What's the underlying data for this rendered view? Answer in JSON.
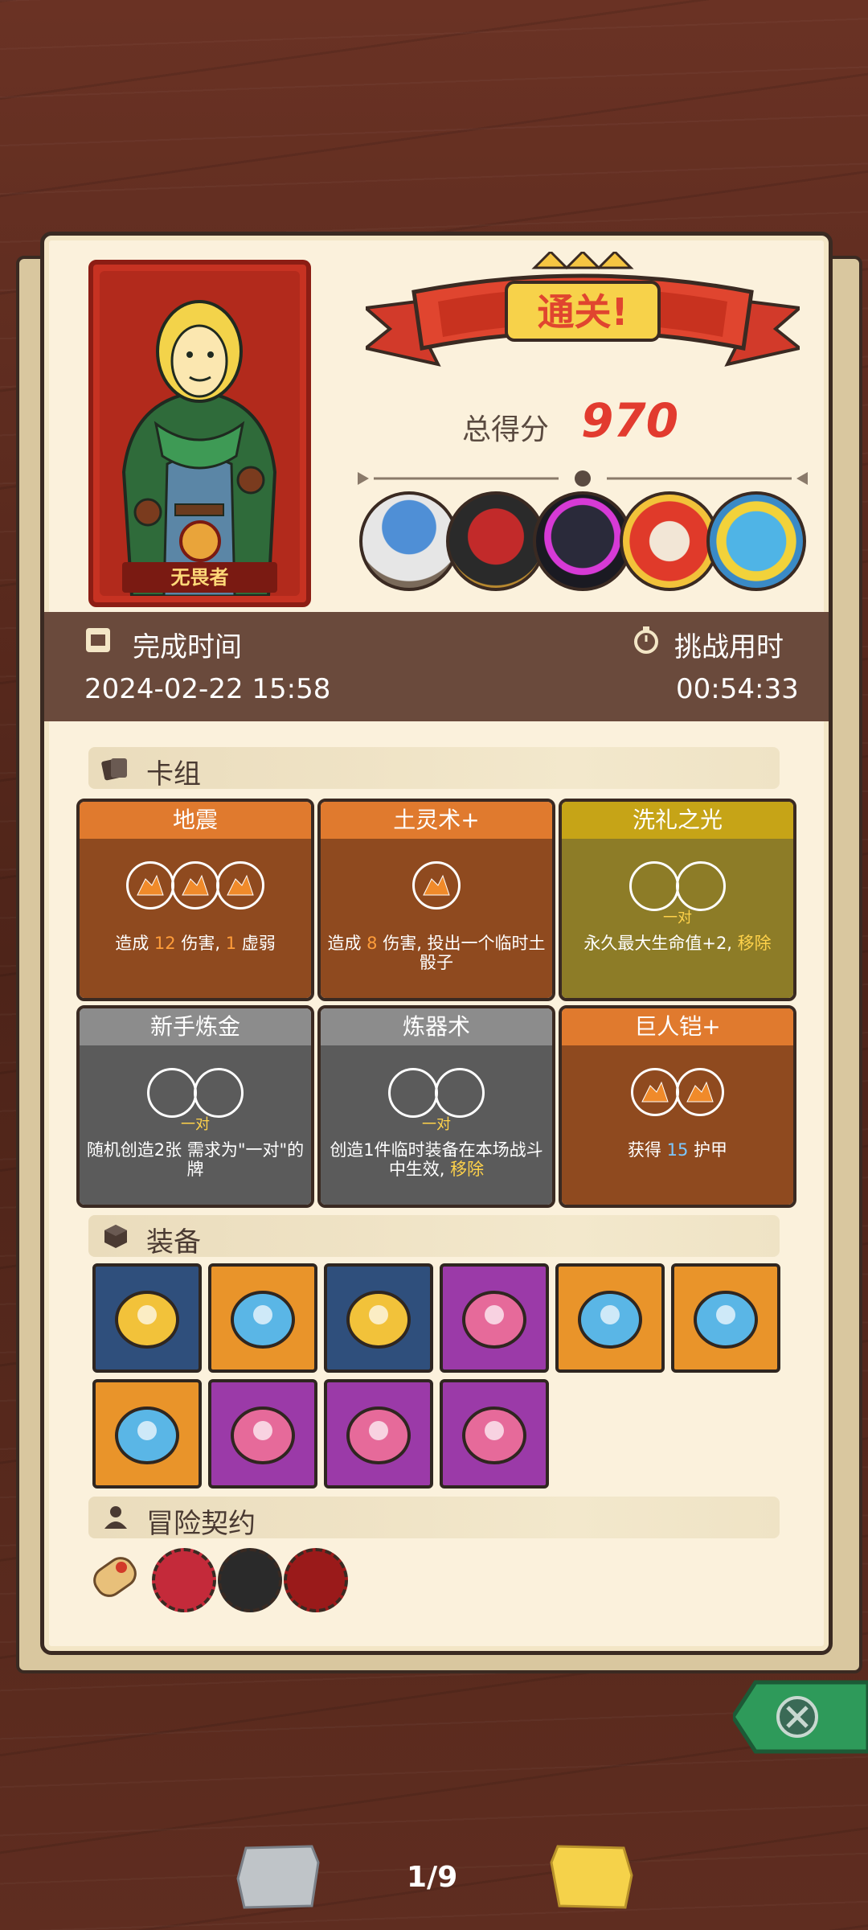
{
  "result": {
    "hero_name": "无畏者",
    "banner_text": "通关!",
    "score_label": "总得分",
    "score_value": "970",
    "bosses": [
      "mushroom-sage-boss",
      "cage-demon-boss",
      "shadow-beast-boss",
      "mask-demon-boss",
      "blue-ogre-boss"
    ]
  },
  "time": {
    "complete_label": "完成时间",
    "complete_value": "2024-02-22 15:58",
    "challenge_label": "挑战用时",
    "challenge_value": "00:54:33"
  },
  "deck": {
    "section_label": "卡组",
    "cards": [
      {
        "title": "地震",
        "color": "brown",
        "costs": 3,
        "pair": "",
        "desc_pre": "造成 ",
        "desc_hl1": "12",
        "desc_mid": " 伤害, ",
        "desc_hl2": "1",
        "desc_post": " 虚弱"
      },
      {
        "title": "土灵术+",
        "color": "brown",
        "costs": 1,
        "pair": "",
        "desc_pre": "造成 ",
        "desc_hl1": "8",
        "desc_mid": " 伤害, 投出一个临时土骰子",
        "desc_hl2": "",
        "desc_post": ""
      },
      {
        "title": "洗礼之光",
        "color": "olive",
        "costs": 0,
        "pair": "一对",
        "desc_pre": "永久最大生命值",
        "desc_hl1": "",
        "desc_mid": "+2, ",
        "desc_hl2": "移除",
        "desc_post": ""
      },
      {
        "title": "新手炼金",
        "color": "gray",
        "costs": 0,
        "pair": "一对",
        "desc_pre": "随机创造2张 需求为\"一对\"的牌",
        "desc_hl1": "",
        "desc_mid": "",
        "desc_hl2": "",
        "desc_post": ""
      },
      {
        "title": "炼器术",
        "color": "gray",
        "costs": 0,
        "pair": "一对",
        "desc_pre": "创造1件临时装备在本场战斗中生效, ",
        "desc_hl1": "",
        "desc_mid": "",
        "desc_hl2": "移除",
        "desc_post": ""
      },
      {
        "title": "巨人铠+",
        "color": "brown",
        "costs": 2,
        "pair": "",
        "desc_pre": "获得 ",
        "desc_hl1": "",
        "desc_mid": "",
        "desc_hl2": "15",
        "desc_post": " 护甲"
      }
    ]
  },
  "equipment": {
    "section_label": "装备",
    "items": [
      {
        "icon": "gold-helmet-icon",
        "bg": "blue"
      },
      {
        "icon": "crystal-shield-icon",
        "bg": "orange"
      },
      {
        "icon": "totem-icon",
        "bg": "blue"
      },
      {
        "icon": "mushroom-cap-icon",
        "bg": "purple"
      },
      {
        "icon": "ring-medallion-icon",
        "bg": "orange"
      },
      {
        "icon": "ornate-mask-icon",
        "bg": "orange"
      },
      {
        "icon": "blue-slime-icon",
        "bg": "orange"
      },
      {
        "icon": "winged-idol-icon",
        "bg": "purple"
      },
      {
        "icon": "gold-mirror-icon",
        "bg": "purple"
      },
      {
        "icon": "round-shield-icon",
        "bg": "purple"
      }
    ]
  },
  "contracts": {
    "section_label": "冒险契约",
    "items": [
      "scroll-icon",
      "red-flame-icon",
      "potion-bottle-icon",
      "red-rune-icon"
    ]
  },
  "nav": {
    "page_indicator": "1/9"
  }
}
